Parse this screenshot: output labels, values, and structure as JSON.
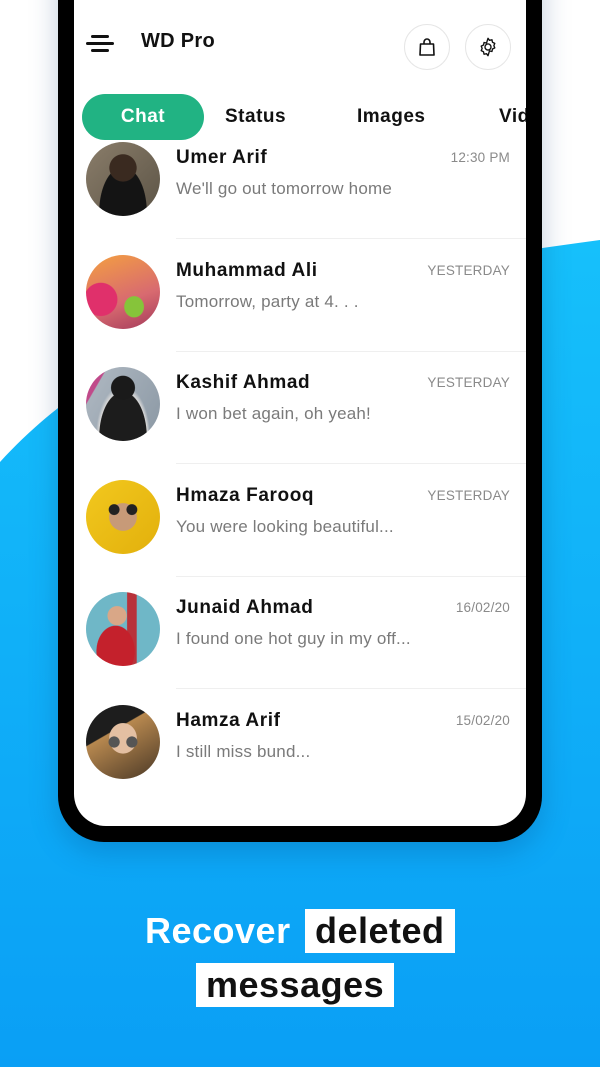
{
  "app": {
    "title": "WD Pro",
    "accent_color": "#21b383",
    "background_color": "#00aaf5"
  },
  "header": {
    "menu_icon": "menu-icon",
    "bag_icon": "shopping-bag-icon",
    "settings_icon": "gear-icon"
  },
  "tabs": [
    {
      "label": "Chat",
      "active": true
    },
    {
      "label": "Status",
      "active": false
    },
    {
      "label": "Images",
      "active": false
    },
    {
      "label": "Vid",
      "active": false
    }
  ],
  "chats": [
    {
      "name": "Umer Arif",
      "message": "We'll go out tomorrow home",
      "time": "12:30 PM"
    },
    {
      "name": "Muhammad Ali",
      "message": "Tomorrow, party at 4. . .",
      "time": "YESTERDAY"
    },
    {
      "name": "Kashif Ahmad",
      "message": "I won bet again, oh yeah!",
      "time": "YESTERDAY"
    },
    {
      "name": "Hmaza Farooq",
      "message": "You were looking beautiful...",
      "time": "YESTERDAY"
    },
    {
      "name": "Junaid Ahmad",
      "message": "I found one hot guy in my off...",
      "time": "16/02/20"
    },
    {
      "name": "Hamza Arif",
      "message": "I still miss bund...",
      "time": "15/02/20"
    }
  ],
  "caption": {
    "word1": "Recover",
    "word2": "deleted",
    "word3": "messages"
  }
}
